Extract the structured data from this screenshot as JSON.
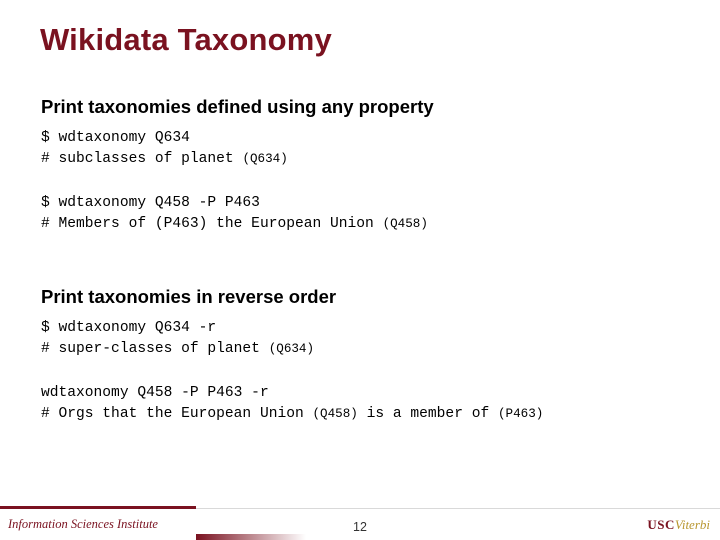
{
  "slide": {
    "title": "Wikidata Taxonomy",
    "sections": [
      {
        "heading": "Print taxonomies defined using any property",
        "blocks": [
          {
            "cmd_prompt": "$ wdtaxonomy Q634",
            "comment_prefix": "# subclasses of planet ",
            "comment_suffix": "(Q634)"
          },
          {
            "cmd_prompt": "$ wdtaxonomy Q458 -P P463",
            "comment_prefix": "# Members of (P463) the European Union ",
            "comment_suffix": "(Q458)"
          }
        ]
      },
      {
        "heading": "Print taxonomies in reverse order",
        "blocks": [
          {
            "cmd_prompt": "$ wdtaxonomy Q634 -r",
            "comment_prefix": "# super-classes of planet ",
            "comment_suffix": "(Q634)"
          },
          {
            "cmd_prompt": "wdtaxonomy Q458 -P P463 -r",
            "comment_prefix": "# Orgs that the European Union ",
            "comment_mid": "(Q458)",
            "comment_tail": " is a member of ",
            "comment_suffix": "(P463)"
          }
        ]
      }
    ]
  },
  "footer": {
    "institute": "Information Sciences Institute",
    "page_number": "12",
    "logo_main": "USC",
    "logo_sub": "Viterbi"
  },
  "colors": {
    "accent": "#7a1220",
    "gold": "#b8962e"
  }
}
